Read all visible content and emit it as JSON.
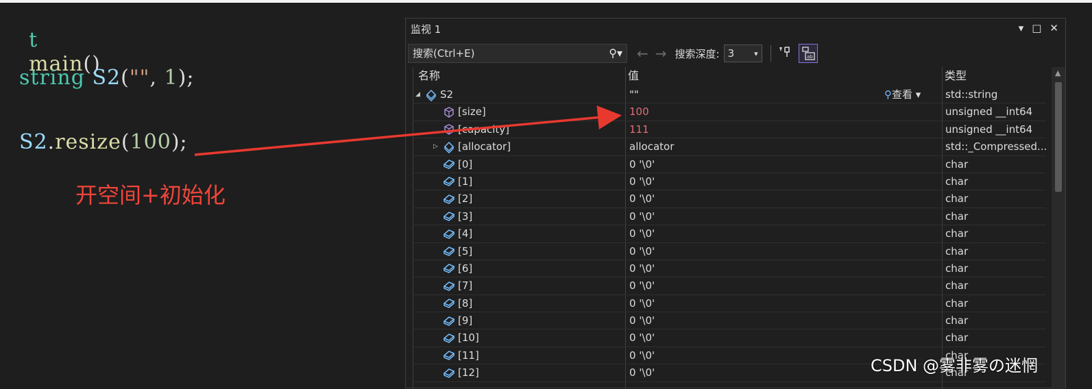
{
  "editor": {
    "line1": {
      "prefix": "t",
      "func": "main",
      "rest": "()"
    },
    "line2": {
      "type": "string",
      "var": "S2",
      "open": "(",
      "str": "\"\"",
      "comma": ", ",
      "num": "1",
      "close": ");"
    },
    "line3": {
      "var": "S2",
      "dot": ".",
      "func": "resize",
      "open": "(",
      "num": "100",
      "close": ");"
    },
    "annotation": "开空间+初始化",
    "arrow_color": "#e8392f"
  },
  "watch": {
    "title": "监视 1",
    "controls": [
      "▾",
      "□",
      "✕"
    ],
    "search_placeholder": "搜索(Ctrl+E)",
    "depth_label": "搜索深度:",
    "depth_value": "3",
    "columns": {
      "name": "名称",
      "value": "值",
      "type": "类型"
    },
    "view_label": "查看",
    "rows": [
      {
        "name": "S2",
        "value": "\"\"",
        "type": "std::string",
        "expander": "◢",
        "icon": "object-icon",
        "indent": 0,
        "red": false
      },
      {
        "name": "[size]",
        "value": "100",
        "type": "unsigned __int64",
        "expander": "",
        "icon": "property-icon",
        "indent": 1,
        "red": true
      },
      {
        "name": "[capacity]",
        "value": "111",
        "type": "unsigned __int64",
        "expander": "",
        "icon": "property-icon",
        "indent": 1,
        "red": true
      },
      {
        "name": "[allocator]",
        "value": "allocator",
        "type": "std::_Compressed...",
        "expander": "▷",
        "icon": "object-icon",
        "indent": 1,
        "red": false
      },
      {
        "name": "[0]",
        "value": "0 '\\0'",
        "type": "char",
        "expander": "",
        "icon": "field-icon",
        "indent": 1,
        "red": false
      },
      {
        "name": "[1]",
        "value": "0 '\\0'",
        "type": "char",
        "expander": "",
        "icon": "field-icon",
        "indent": 1,
        "red": false
      },
      {
        "name": "[2]",
        "value": "0 '\\0'",
        "type": "char",
        "expander": "",
        "icon": "field-icon",
        "indent": 1,
        "red": false
      },
      {
        "name": "[3]",
        "value": "0 '\\0'",
        "type": "char",
        "expander": "",
        "icon": "field-icon",
        "indent": 1,
        "red": false
      },
      {
        "name": "[4]",
        "value": "0 '\\0'",
        "type": "char",
        "expander": "",
        "icon": "field-icon",
        "indent": 1,
        "red": false
      },
      {
        "name": "[5]",
        "value": "0 '\\0'",
        "type": "char",
        "expander": "",
        "icon": "field-icon",
        "indent": 1,
        "red": false
      },
      {
        "name": "[6]",
        "value": "0 '\\0'",
        "type": "char",
        "expander": "",
        "icon": "field-icon",
        "indent": 1,
        "red": false
      },
      {
        "name": "[7]",
        "value": "0 '\\0'",
        "type": "char",
        "expander": "",
        "icon": "field-icon",
        "indent": 1,
        "red": false
      },
      {
        "name": "[8]",
        "value": "0 '\\0'",
        "type": "char",
        "expander": "",
        "icon": "field-icon",
        "indent": 1,
        "red": false
      },
      {
        "name": "[9]",
        "value": "0 '\\0'",
        "type": "char",
        "expander": "",
        "icon": "field-icon",
        "indent": 1,
        "red": false
      },
      {
        "name": "[10]",
        "value": "0 '\\0'",
        "type": "char",
        "expander": "",
        "icon": "field-icon",
        "indent": 1,
        "red": false
      },
      {
        "name": "[11]",
        "value": "0 '\\0'",
        "type": "char",
        "expander": "",
        "icon": "field-icon",
        "indent": 1,
        "red": false
      },
      {
        "name": "[12]",
        "value": "0 '\\0'",
        "type": "char",
        "expander": "",
        "icon": "field-icon",
        "indent": 1,
        "red": false
      }
    ]
  },
  "watermark": "CSDN @雾非雾の迷惘",
  "colors": {
    "accent": "#8a72d8",
    "value_changed": "#e06c75",
    "annotation": "#f0453a"
  }
}
